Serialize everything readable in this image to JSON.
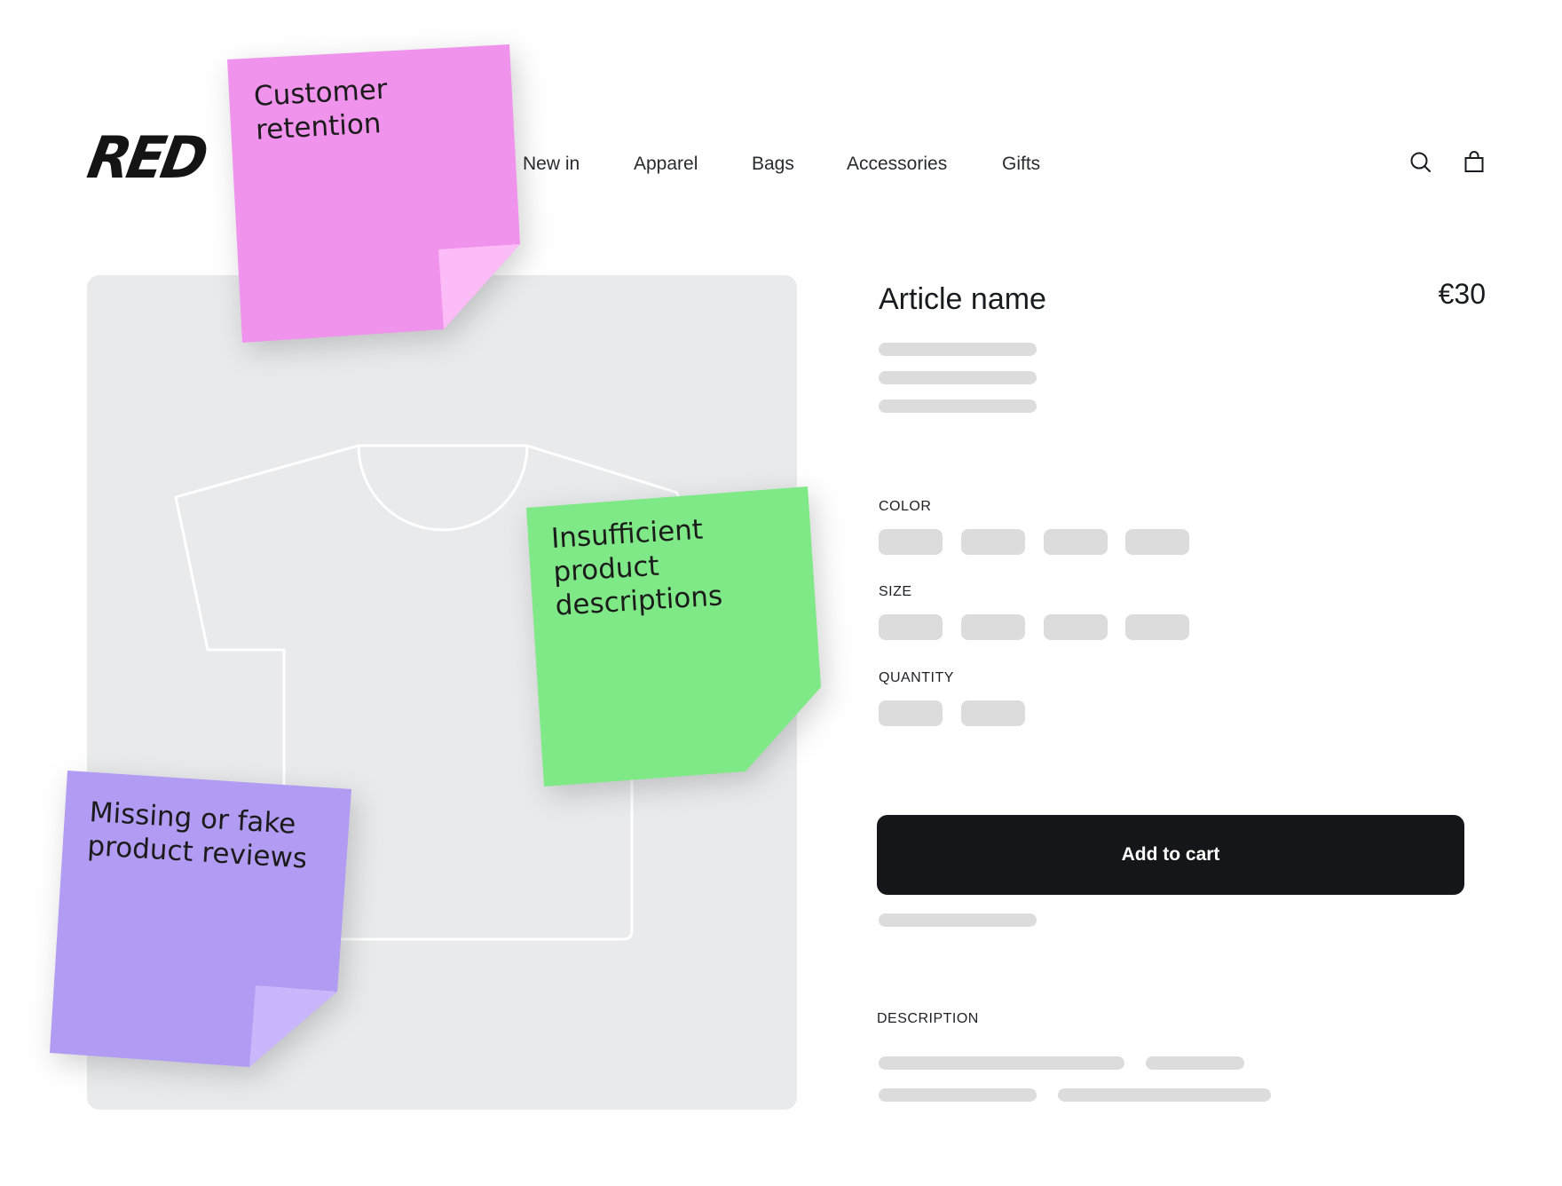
{
  "brand": {
    "logo_text": "RED"
  },
  "nav": {
    "items": [
      {
        "label": "New in"
      },
      {
        "label": "Apparel"
      },
      {
        "label": "Bags"
      },
      {
        "label": "Accessories"
      },
      {
        "label": "Gifts"
      }
    ]
  },
  "header_icons": {
    "search": "search-icon",
    "cart": "shopping-bag-icon"
  },
  "product": {
    "name": "Article name",
    "price": "€30",
    "image_icon": "t-shirt-icon"
  },
  "options": {
    "color_label": "COLOR",
    "size_label": "SIZE",
    "quantity_label": "QUANTITY"
  },
  "cart": {
    "add_label": "Add to cart"
  },
  "description": {
    "label": "DESCRIPTION"
  },
  "notes": {
    "customer_retention": "Customer\nretention",
    "insufficient_descriptions": "Insufficient\nproduct\ndescriptions",
    "fake_reviews": "Missing or fake\nproduct reviews"
  },
  "colors": {
    "note_pink": "#f093ec",
    "note_green": "#7ee986",
    "note_purple": "#b19bf3",
    "button_dark": "#151619",
    "skeleton": "#dcdcdc",
    "image_bg": "#e9eaec"
  }
}
